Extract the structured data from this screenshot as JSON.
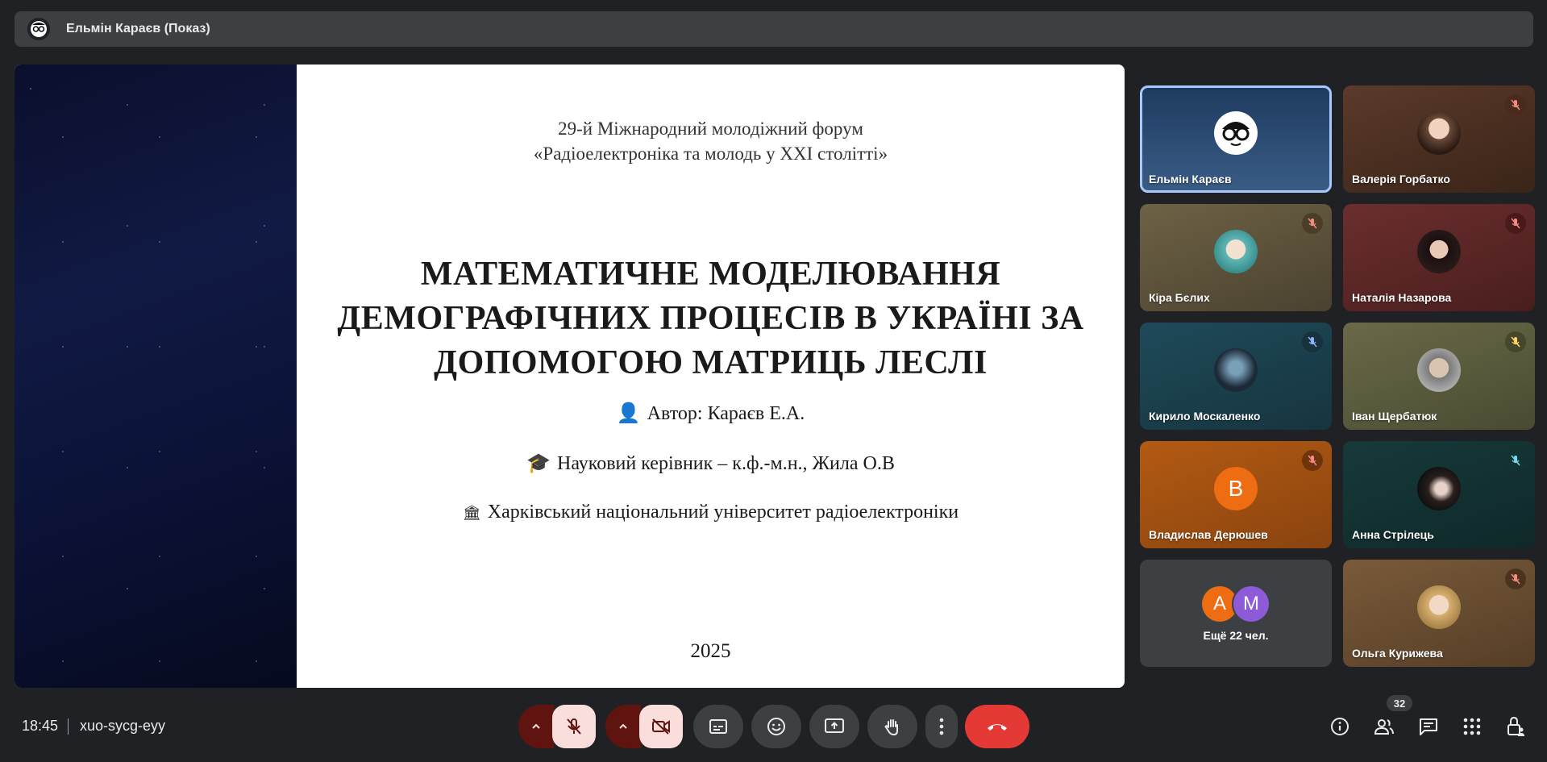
{
  "presenter_bar": {
    "title": "Ельмін Караєв (Показ)"
  },
  "slide": {
    "forum_line1": "29-й Міжнародний молодіжний форум",
    "forum_line2": "«Радіоелектроніка та молодь у XXI столітті»",
    "title_line1": "МАТЕМАТИЧНЕ МОДЕЛЮВАННЯ",
    "title_line2": "ДЕМОГРАФІЧНИХ ПРОЦЕСІВ В УКРАЇНІ ЗА",
    "title_line3": "ДОПОМОГОЮ МАТРИЦЬ ЛЕСЛІ",
    "author_emoji": "👤",
    "author": "Автор: Караєв Е.А.",
    "supervisor_emoji": "🎓",
    "supervisor": "Науковий керівник – к.ф.-м.н., Жила О.В",
    "university_emoji": "🏛",
    "university": "Харківський національний університет радіоелектроніки",
    "year": "2025"
  },
  "participants": [
    {
      "name": "Ельмін Караєв",
      "muted": false,
      "active": true
    },
    {
      "name": "Валерія Горбатко",
      "muted": true
    },
    {
      "name": "Кіра Бєлих",
      "muted": true
    },
    {
      "name": "Наталія Назарова",
      "muted": true
    },
    {
      "name": "Кирило Москаленко",
      "muted": true
    },
    {
      "name": "Іван Щербатюк",
      "muted": true
    },
    {
      "name": "Владислав Дерюшев",
      "muted": true,
      "initial": "B"
    },
    {
      "name": "Анна Стрілець",
      "muted": true
    },
    {
      "name": "Ольга Курижева",
      "muted": true
    }
  ],
  "others_tile": {
    "initial_a": "A",
    "initial_b": "M",
    "label": "Ещё 22 чел."
  },
  "bottom_bar": {
    "time": "18:45",
    "meeting_code": "xuo-sycg-eyy",
    "participant_count": "32"
  },
  "colors": {
    "end_call": "#e53935",
    "muted_ctrl": "#f9dedc",
    "chevron_bg": "#601410",
    "active_border": "#a8c7fa"
  }
}
